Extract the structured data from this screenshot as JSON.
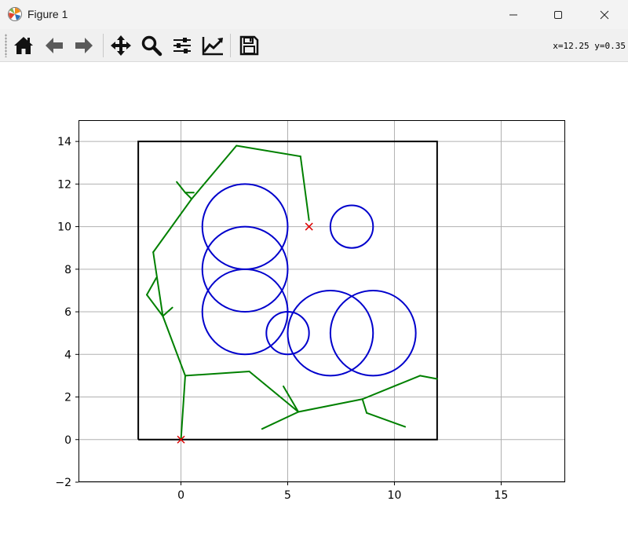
{
  "window": {
    "title": "Figure 1"
  },
  "toolbar": {
    "items": [
      "home-icon",
      "back-icon",
      "forward-icon",
      "pan-icon",
      "zoom-icon",
      "configure-subplots-icon",
      "edit-axes-icon",
      "save-icon"
    ],
    "coords": "x=12.25 y=0.35"
  },
  "chart_data": {
    "type": "line",
    "xlim": [
      -4.8,
      18
    ],
    "ylim": [
      -2,
      15
    ],
    "xticks": [
      0,
      5,
      10,
      15
    ],
    "yticks": [
      -2,
      0,
      2,
      4,
      6,
      8,
      10,
      12,
      14
    ],
    "grid": true,
    "boundary": {
      "color": "#000000",
      "points": [
        [
          -2,
          0
        ],
        [
          12,
          0
        ],
        [
          12,
          14
        ],
        [
          -2,
          14
        ],
        [
          -2,
          0
        ]
      ]
    },
    "obstacles": {
      "color": "#0000cc",
      "circles": [
        {
          "cx": 3,
          "cy": 10,
          "r": 2
        },
        {
          "cx": 3,
          "cy": 8,
          "r": 2
        },
        {
          "cx": 3,
          "cy": 6,
          "r": 2
        },
        {
          "cx": 5,
          "cy": 5,
          "r": 1
        },
        {
          "cx": 7,
          "cy": 5,
          "r": 2
        },
        {
          "cx": 9,
          "cy": 5,
          "r": 2
        },
        {
          "cx": 8,
          "cy": 10,
          "r": 1
        }
      ]
    },
    "tree": {
      "color": "#008000",
      "edges": [
        [
          [
            0,
            0
          ],
          [
            0.2,
            3.0
          ]
        ],
        [
          [
            0.2,
            3.0
          ],
          [
            -0.85,
            5.8
          ]
        ],
        [
          [
            0.2,
            3.0
          ],
          [
            3.2,
            3.2
          ]
        ],
        [
          [
            3.2,
            3.2
          ],
          [
            5.5,
            1.3
          ]
        ],
        [
          [
            5.5,
            1.3
          ],
          [
            4.8,
            2.5
          ]
        ],
        [
          [
            5.5,
            1.3
          ],
          [
            3.8,
            0.5
          ]
        ],
        [
          [
            5.5,
            1.3
          ],
          [
            8.5,
            1.9
          ]
        ],
        [
          [
            8.5,
            1.9
          ],
          [
            8.7,
            1.25
          ]
        ],
        [
          [
            8.7,
            1.25
          ],
          [
            10.5,
            0.6
          ]
        ],
        [
          [
            8.5,
            1.9
          ],
          [
            11.2,
            3.0
          ]
        ],
        [
          [
            11.2,
            3.0
          ],
          [
            12,
            2.85
          ]
        ],
        [
          [
            -0.85,
            5.8
          ],
          [
            -0.4,
            6.2
          ]
        ],
        [
          [
            -0.85,
            5.8
          ],
          [
            -1.6,
            6.8
          ]
        ],
        [
          [
            -1.6,
            6.8
          ],
          [
            -1.15,
            7.6
          ]
        ],
        [
          [
            -0.85,
            5.8
          ],
          [
            -1.3,
            8.8
          ]
        ],
        [
          [
            -1.3,
            8.8
          ],
          [
            0.5,
            11.3
          ]
        ],
        [
          [
            0.5,
            11.3
          ],
          [
            0.2,
            11.6
          ]
        ],
        [
          [
            0.2,
            11.6
          ],
          [
            -0.2,
            12.1
          ]
        ],
        [
          [
            0.2,
            11.6
          ],
          [
            0.6,
            11.6
          ]
        ],
        [
          [
            0.5,
            11.3
          ],
          [
            2.6,
            13.8
          ]
        ],
        [
          [
            2.6,
            13.8
          ],
          [
            5.6,
            13.3
          ]
        ],
        [
          [
            5.6,
            13.3
          ],
          [
            6.0,
            10.3
          ]
        ]
      ]
    },
    "markers": {
      "color": "#dd0000",
      "points": [
        {
          "x": 0,
          "y": 0
        },
        {
          "x": 6,
          "y": 10
        }
      ]
    }
  }
}
